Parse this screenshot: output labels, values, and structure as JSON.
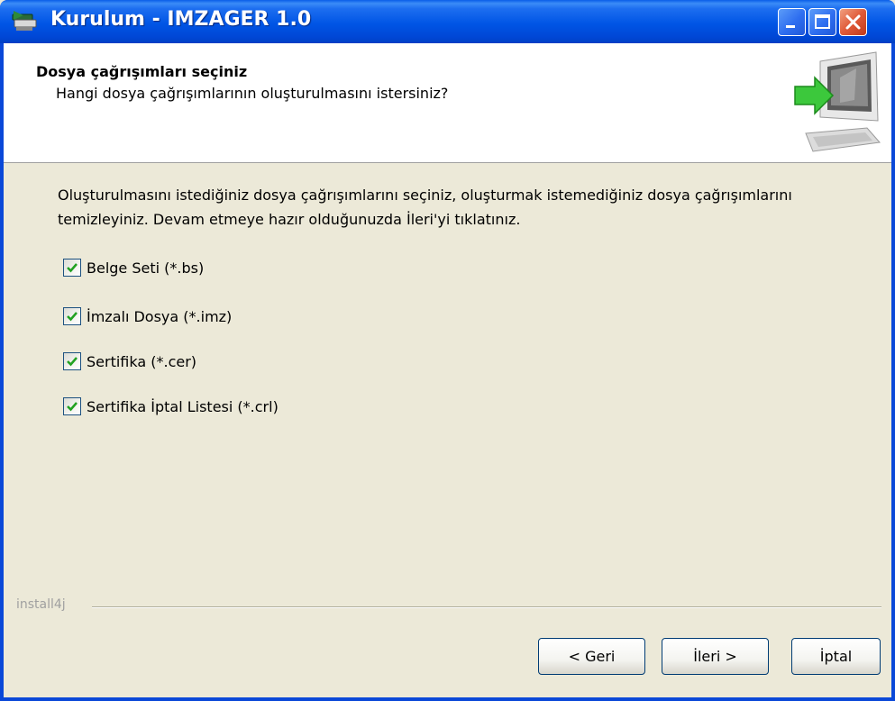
{
  "window": {
    "title": "Kurulum - IMZAGER 1.0"
  },
  "header": {
    "title": "Dosya çağrışımları seçiniz",
    "subtitle": "Hangi dosya çağrışımlarının oluşturulmasını istersiniz?"
  },
  "description": "Oluşturulmasını istediğiniz dosya çağrışımlarını seçiniz, oluşturmak istemediğiniz dosya çağrışımlarını temizleyiniz. Devam etmeye hazır olduğunuzda İleri'yi tıklatınız.",
  "options": [
    {
      "label": "Belge Seti (*.bs)",
      "checked": true
    },
    {
      "label": "İmzalı Dosya (*.imz)",
      "checked": true
    },
    {
      "label": "Sertifika (*.cer)",
      "checked": true
    },
    {
      "label": "Sertifika İptal Listesi (*.crl)",
      "checked": true
    }
  ],
  "footer": {
    "brand": "install4j",
    "back_label": "< Geri",
    "next_label": "İleri >",
    "cancel_label": "İptal"
  },
  "colors": {
    "titlebar": "#0055e5",
    "check": "#21a121",
    "close_button": "#e05a38"
  },
  "icons": {
    "app": "installer-icon",
    "header": "computer-arrow-icon",
    "minimize": "minimize-icon",
    "maximize": "maximize-icon",
    "close": "close-icon",
    "check": "checkmark-icon"
  }
}
